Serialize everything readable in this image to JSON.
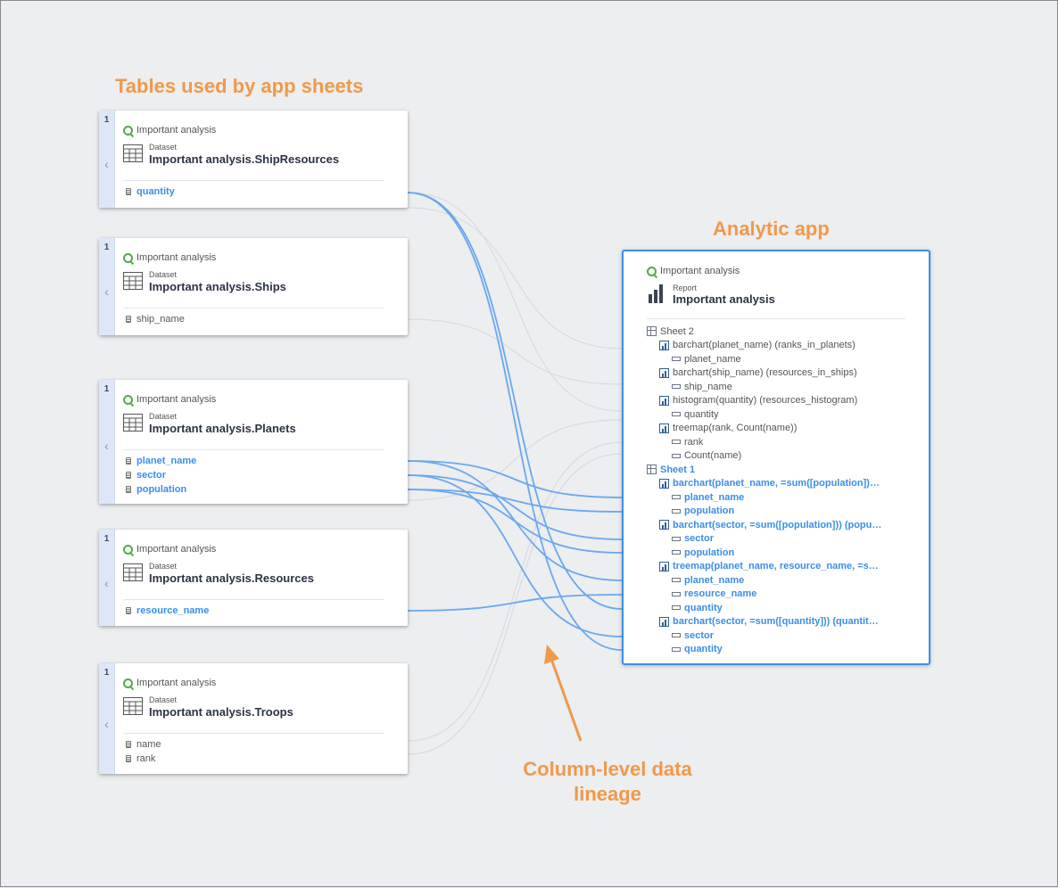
{
  "annotations": {
    "tables": "Tables used by app sheets",
    "app": "Analytic app",
    "lineage_line1": "Column-level data",
    "lineage_line2": "lineage"
  },
  "colors": {
    "accent": "#3b8ee8",
    "annotation": "#f0994a",
    "lineage_line": "#6aa8ef",
    "faint_line": "#d8dbe0"
  },
  "datasets": [
    {
      "count": "1",
      "source": "Important analysis",
      "kind": "Dataset",
      "title": "Important analysis.ShipResources",
      "columns": [
        {
          "name": "quantity",
          "highlighted": true
        }
      ]
    },
    {
      "count": "1",
      "source": "Important analysis",
      "kind": "Dataset",
      "title": "Important analysis.Ships",
      "columns": [
        {
          "name": "ship_name",
          "highlighted": false
        }
      ]
    },
    {
      "count": "1",
      "source": "Important analysis",
      "kind": "Dataset",
      "title": "Important analysis.Planets",
      "columns": [
        {
          "name": "planet_name",
          "highlighted": true
        },
        {
          "name": "sector",
          "highlighted": true
        },
        {
          "name": "population",
          "highlighted": true
        }
      ]
    },
    {
      "count": "1",
      "source": "Important analysis",
      "kind": "Dataset",
      "title": "Important analysis.Resources",
      "columns": [
        {
          "name": "resource_name",
          "highlighted": true
        }
      ]
    },
    {
      "count": "1",
      "source": "Important analysis",
      "kind": "Dataset",
      "title": "Important analysis.Troops",
      "columns": [
        {
          "name": "name",
          "highlighted": false
        },
        {
          "name": "rank",
          "highlighted": false
        }
      ]
    }
  ],
  "app": {
    "source": "Important analysis",
    "kind": "Report",
    "title": "Important analysis",
    "tree": [
      {
        "type": "sheet",
        "level": 0,
        "label": "Sheet 2",
        "highlighted": false
      },
      {
        "type": "viz",
        "level": 1,
        "label": "barchart(planet_name) (ranks_in_planets)",
        "highlighted": false
      },
      {
        "type": "field",
        "level": 2,
        "label": "planet_name",
        "highlighted": false
      },
      {
        "type": "viz",
        "level": 1,
        "label": "barchart(ship_name) (resources_in_ships)",
        "highlighted": false
      },
      {
        "type": "field",
        "level": 2,
        "label": "ship_name",
        "highlighted": false
      },
      {
        "type": "viz",
        "level": 1,
        "label": "histogram(quantity) (resources_histogram)",
        "highlighted": false
      },
      {
        "type": "field",
        "level": 2,
        "label": "quantity",
        "highlighted": false
      },
      {
        "type": "viz",
        "level": 1,
        "label": "treemap(rank, Count(name))",
        "highlighted": false
      },
      {
        "type": "field",
        "level": 2,
        "label": "rank",
        "highlighted": false
      },
      {
        "type": "field",
        "level": 2,
        "label": "Count(name)",
        "highlighted": false
      },
      {
        "type": "sheet",
        "level": 0,
        "label": "Sheet 1",
        "highlighted": true
      },
      {
        "type": "viz",
        "level": 1,
        "label": "barchart(planet_name, =sum([population])…",
        "highlighted": true
      },
      {
        "type": "field",
        "level": 2,
        "label": "planet_name",
        "highlighted": true
      },
      {
        "type": "field",
        "level": 2,
        "label": "population",
        "highlighted": true
      },
      {
        "type": "viz",
        "level": 1,
        "label": "barchart(sector, =sum([population])) (popu…",
        "highlighted": true
      },
      {
        "type": "field",
        "level": 2,
        "label": "sector",
        "highlighted": true
      },
      {
        "type": "field",
        "level": 2,
        "label": "population",
        "highlighted": true
      },
      {
        "type": "viz",
        "level": 1,
        "label": "treemap(planet_name, resource_name, =s…",
        "highlighted": true
      },
      {
        "type": "field",
        "level": 2,
        "label": "planet_name",
        "highlighted": true
      },
      {
        "type": "field",
        "level": 2,
        "label": "resource_name",
        "highlighted": true
      },
      {
        "type": "field",
        "level": 2,
        "label": "quantity",
        "highlighted": true
      },
      {
        "type": "viz",
        "level": 1,
        "label": "barchart(sector, =sum([quantity])) (quantit…",
        "highlighted": true
      },
      {
        "type": "field",
        "level": 2,
        "label": "sector",
        "highlighted": true
      },
      {
        "type": "field",
        "level": 2,
        "label": "quantity",
        "highlighted": true
      }
    ]
  }
}
